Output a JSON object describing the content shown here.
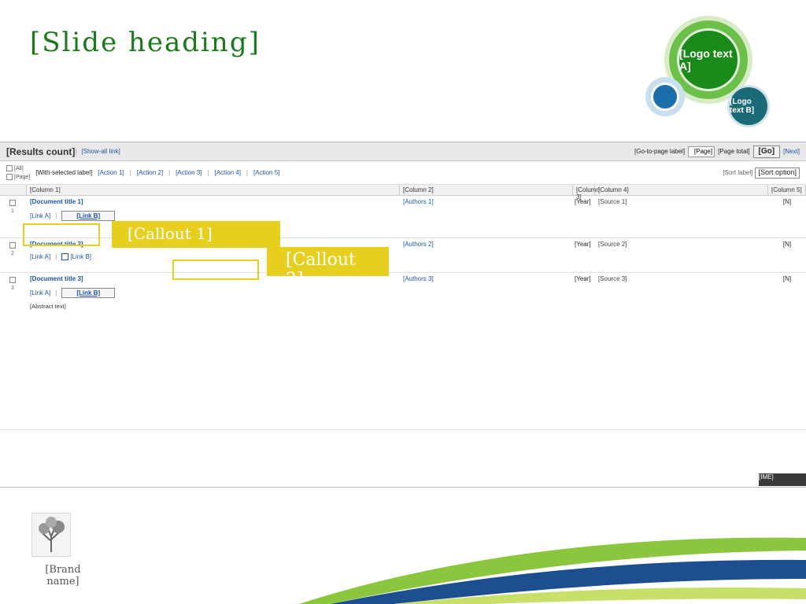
{
  "slide": {
    "title": "[Slide heading]"
  },
  "logo": {
    "main": "[Logo text A]",
    "secondary": "[Logo text B]"
  },
  "search": {
    "results_label": "[Results count]",
    "show_all": "[Show-all link]",
    "goto_label": "[Go-to-page label]",
    "page_value": "[Page]",
    "page_total": "[Page total]",
    "go": "[Go]",
    "next": "[Next]"
  },
  "toolbar": {
    "all": "[All]",
    "page": "[Page]",
    "with_selected": "[With-selected label]",
    "actions": [
      "[Action 1]",
      "[Action 2]",
      "[Action 3]",
      "[Action 4]",
      "[Action 5]"
    ],
    "sort_label": "[Sort label]",
    "sort_value": "[Sort option]"
  },
  "columns": [
    "[Column 1]",
    "[Column 2]",
    "[Column 3]",
    "[Column 4]",
    "[Column 5]"
  ],
  "rows": [
    {
      "num": "1",
      "title": "[Document title 1]",
      "authors": "[Authors 1]",
      "year": "[Year]",
      "source": "[Source 1]",
      "citations": "[N]",
      "link1": "[Link A]",
      "link2": "[Link B]"
    },
    {
      "num": "2",
      "title": "[Document title 2]",
      "authors": "[Authors 2]",
      "year": "[Year]",
      "source": "[Source 2]",
      "citations": "[N]",
      "link1": "[Link A]",
      "link2": "[Link B]"
    },
    {
      "num": "3",
      "title": "[Document title 3]",
      "authors": "[Authors 3]",
      "year": "[Year]",
      "source": "[Source 3]",
      "citations": "[N]",
      "link1": "[Link A]",
      "link2": "[Link B]",
      "abstract": "[Abstract text]"
    }
  ],
  "callouts": {
    "first": "[Callout 1]",
    "second": "[Callout 2]"
  },
  "ime": "[IME]",
  "footer": {
    "brand": "[Brand name]"
  },
  "colors": {
    "title": "#1a7a1a",
    "link": "#1f55a5",
    "callout": "#e6cf1f",
    "swoosh_green": "#8cc63f",
    "swoosh_blue": "#1d4e8f"
  }
}
